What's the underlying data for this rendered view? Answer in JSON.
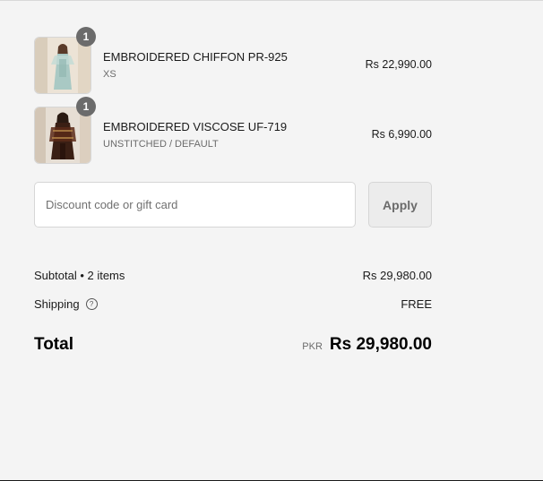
{
  "line_items": [
    {
      "quantity": "1",
      "title": "EMBROIDERED CHIFFON PR-925",
      "variant": "XS",
      "price": "Rs 22,990.00",
      "image_name": "product-image-chiffon"
    },
    {
      "quantity": "1",
      "title": "EMBROIDERED VISCOSE UF-719",
      "variant": "UNSTITCHED / DEFAULT",
      "price": "Rs 6,990.00",
      "image_name": "product-image-viscose"
    }
  ],
  "discount": {
    "placeholder": "Discount code or gift card",
    "apply_label": "Apply"
  },
  "summary": {
    "subtotal_label": "Subtotal • 2 items",
    "subtotal_value": "Rs 29,980.00",
    "shipping_label": "Shipping",
    "shipping_value": "FREE",
    "total_label": "Total",
    "currency_code": "PKR",
    "total_value": "Rs 29,980.00"
  },
  "colors": {
    "background": "#f4f4f4",
    "badge": "#6b6b6b",
    "muted_text": "#6b6b6b",
    "border": "#d6d6d6"
  }
}
